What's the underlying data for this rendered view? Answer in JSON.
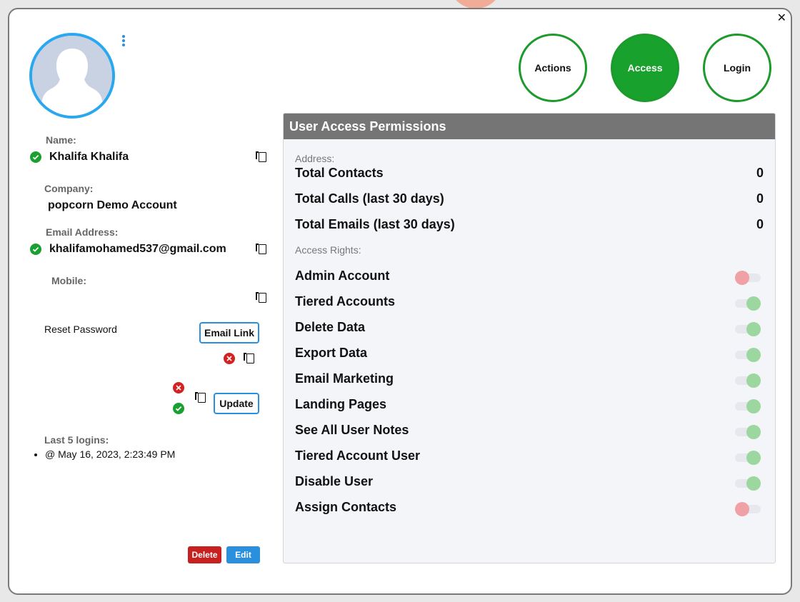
{
  "profile": {
    "name_label": "Name:",
    "name": "Khalifa Khalifa",
    "company_label": "Company:",
    "company": "popcorn Demo Account",
    "email_label": "Email Address:",
    "email": "khalifamohamed537@gmail.com",
    "mobile_label": "Mobile:",
    "reset_label": "Reset Password",
    "email_link_button": "Email Link",
    "update_button": "Update",
    "logins_label": "Last 5 logins:",
    "logins": [
      "@ May 16, 2023, 2:23:49 PM"
    ],
    "delete_button": "Delete",
    "edit_button": "Edit"
  },
  "tabs": {
    "actions": "Actions",
    "access": "Access",
    "login": "Login",
    "active": "access"
  },
  "panel": {
    "title": "User Access Permissions",
    "address_label": "Address:",
    "stats": [
      {
        "label": "Total Contacts",
        "value": "0"
      },
      {
        "label": "Total Calls (last 30 days)",
        "value": "0"
      },
      {
        "label": "Total Emails (last 30 days)",
        "value": "0"
      }
    ],
    "rights_label": "Access Rights:",
    "rights": [
      {
        "label": "Admin Account",
        "on": false
      },
      {
        "label": "Tiered Accounts",
        "on": true
      },
      {
        "label": "Delete Data",
        "on": true
      },
      {
        "label": "Export Data",
        "on": true
      },
      {
        "label": "Email Marketing",
        "on": true
      },
      {
        "label": "Landing Pages",
        "on": true
      },
      {
        "label": "See All User Notes",
        "on": true
      },
      {
        "label": "Tiered Account User",
        "on": true
      },
      {
        "label": "Disable User",
        "on": true
      },
      {
        "label": "Assign Contacts",
        "on": false
      }
    ]
  },
  "colors": {
    "accent_blue": "#2a8fdc",
    "success_green": "#18a12c",
    "danger_red": "#c81f1f",
    "panel_header": "#757575"
  }
}
